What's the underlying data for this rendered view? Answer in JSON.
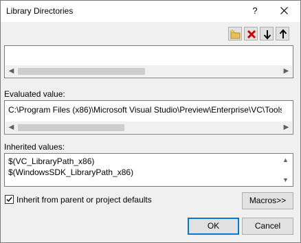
{
  "window": {
    "title": "Library Directories",
    "help_glyph": "?",
    "close_icon": "close-icon"
  },
  "toolbar": {
    "buttons": [
      {
        "icon": "new-folder-icon",
        "tooltip": ""
      },
      {
        "icon": "delete-icon"
      },
      {
        "icon": "move-down-icon"
      },
      {
        "icon": "move-up-icon"
      }
    ]
  },
  "sections": {
    "evaluated_label": "Evaluated value:",
    "evaluated_text": "C:\\Program Files (x86)\\Microsoft Visual Studio\\Preview\\Enterprise\\VC\\Tools",
    "inherited_label": "Inherited values:",
    "inherited_lines": [
      "$(VC_LibraryPath_x86)",
      "$(WindowsSDK_LibraryPath_x86)"
    ]
  },
  "inherit": {
    "label": "Inherit from parent or project defaults",
    "checked": true
  },
  "buttons": {
    "macros": "Macros>>",
    "ok": "OK",
    "cancel": "Cancel"
  },
  "colors": {
    "accent": "#0078d7",
    "delete_red": "#cc0000"
  }
}
